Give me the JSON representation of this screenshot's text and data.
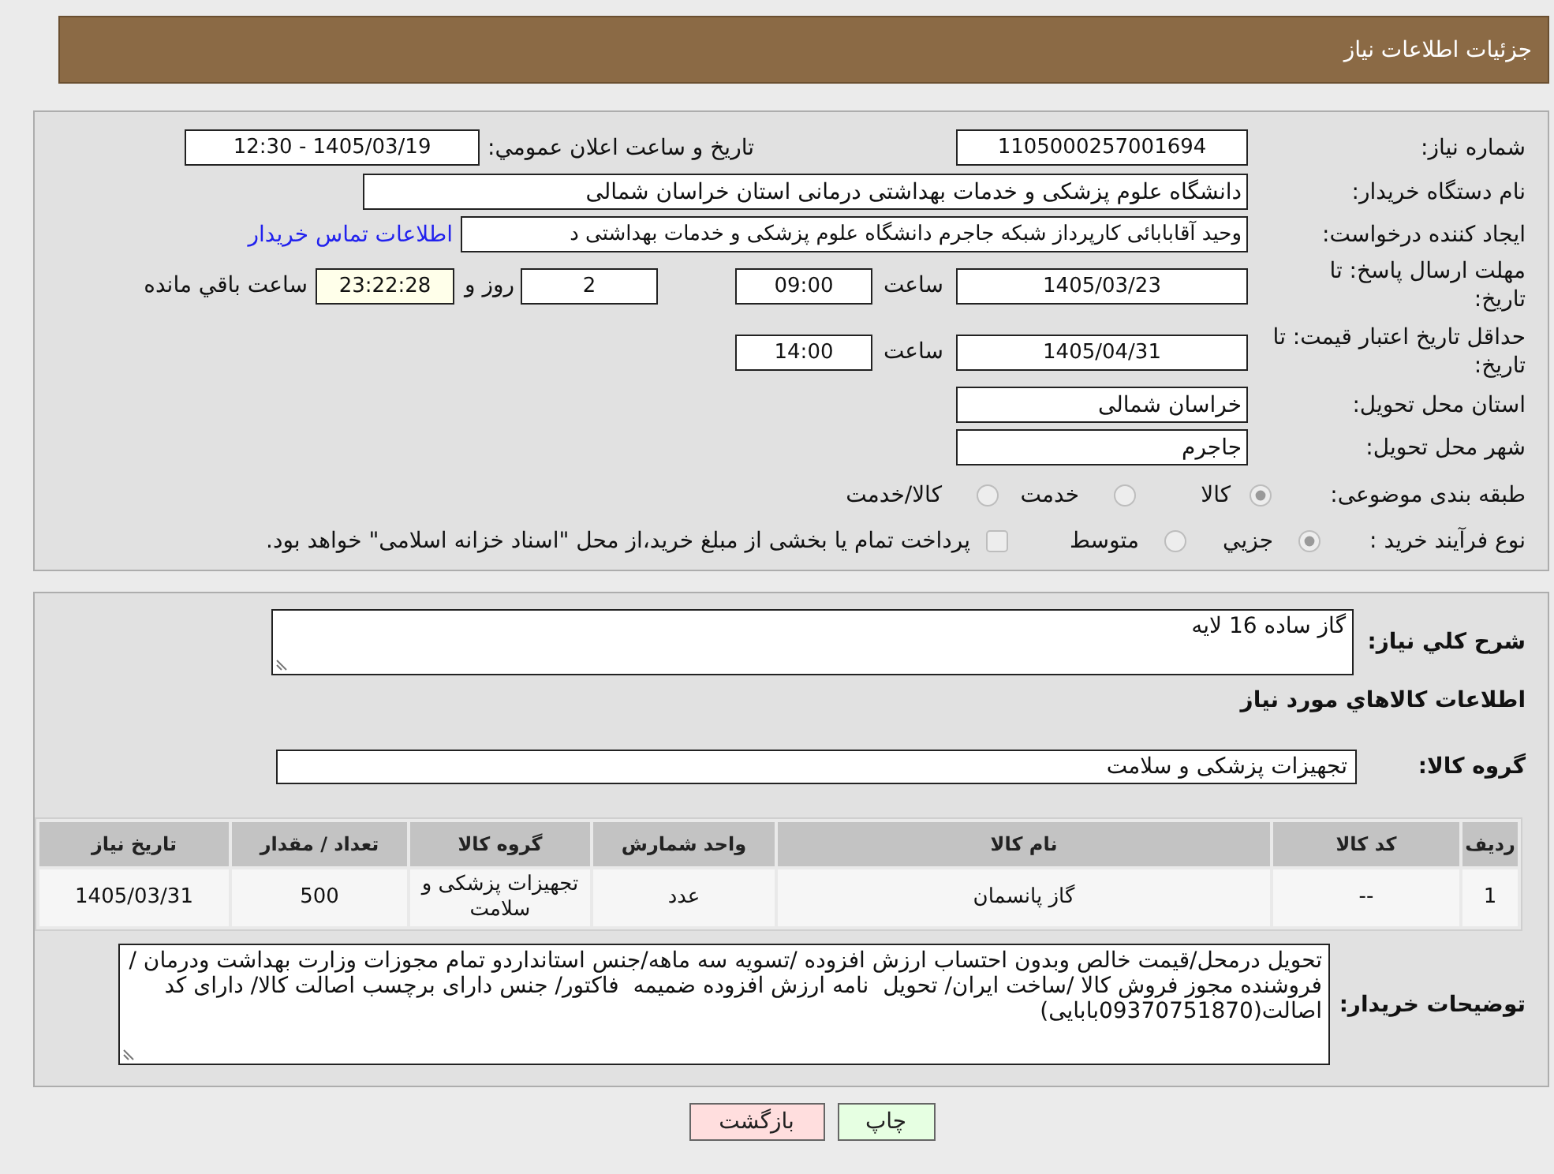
{
  "header": {
    "title": "جزئیات اطلاعات نیاز"
  },
  "details": {
    "need_number": {
      "label": "شماره نیاز:",
      "value": "1105000257001694"
    },
    "announce": {
      "label": "تاريخ و ساعت اعلان عمومي:",
      "value": "1405/03/19 - 12:30"
    },
    "buyer_org": {
      "label": "نام دستگاه خریدار:",
      "value": "دانشگاه علوم پزشکی و خدمات بهداشتی درمانی استان خراسان شمالی"
    },
    "requester": {
      "label": "ایجاد کننده درخواست:",
      "value": "وحید آقابابائی کارپرداز شبکه جاجرم دانشگاه علوم پزشکی و خدمات بهداشتی د",
      "link": "اطلاعات تماس خریدار"
    },
    "response_deadline": {
      "label": "مهلت ارسال پاسخ: تا تاریخ:",
      "date": "1405/03/23",
      "time_label": "ساعت",
      "time": "09:00",
      "days": "2",
      "days_label": "روز و",
      "remaining": "23:22:28",
      "remaining_label": "ساعت باقي مانده"
    },
    "price_validity": {
      "label": "حداقل تاریخ اعتبار قیمت: تا تاریخ:",
      "date": "1405/04/31",
      "time_label": "ساعت",
      "time": "14:00"
    },
    "province": {
      "label": "استان محل تحویل:",
      "value": "خراسان شمالی"
    },
    "city": {
      "label": "شهر محل تحویل:",
      "value": "جاجرم"
    },
    "category": {
      "label": "طبقه بندی موضوعی:",
      "options": [
        {
          "label": "كالا",
          "selected": true
        },
        {
          "label": "خدمت",
          "selected": false
        },
        {
          "label": "کالا/خدمت",
          "selected": false
        }
      ]
    },
    "purchase_type": {
      "label": "نوع فرآیند خرید :",
      "options": [
        {
          "label": "جزيي",
          "selected": true
        },
        {
          "label": "متوسط",
          "selected": false
        }
      ],
      "treasury": {
        "label": "پرداخت تمام یا بخشی از مبلغ خرید،از محل \"اسناد خزانه اسلامی\" خواهد بود.",
        "checked": false
      }
    }
  },
  "need": {
    "description": {
      "label": "شرح كلي نياز:",
      "value": "گاز ساده 16 لایه"
    },
    "goods_heading": "اطلاعات كالاهاي مورد نياز",
    "goods_group": {
      "label": "گروه کالا:",
      "value": "تجهیزات پزشکی و سلامت"
    },
    "table": {
      "columns": [
        "ردیف",
        "کد کالا",
        "نام کالا",
        "واحد شمارش",
        "گروه کالا",
        "تعداد / مقدار",
        "تاریخ نیاز"
      ],
      "rows": [
        [
          "1",
          "--",
          "گاز پانسمان",
          "عدد",
          "تجهیزات پزشکی و سلامت",
          "500",
          "1405/03/31"
        ]
      ]
    },
    "buyer_notes": {
      "label": "توضیحات خریدار:",
      "value": "تحویل درمحل/قیمت خالص وبدون احتساب ارزش افزوده /تسویه سه ماهه/جنس استانداردو تمام مجوزات وزارت بهداشت ودرمان /فروشنده مجوز فروش کالا /ساخت ایران/ تحویل  نامه ارزش افزوده ضمیمه  فاکتور/ جنس دارای برچسب اصالت کالا/ دارای کد اصالت(09370751870بابایی)"
    }
  },
  "buttons": [
    {
      "label": "چاپ",
      "kind": "print"
    },
    {
      "label": "بازگشت",
      "kind": "back"
    }
  ]
}
